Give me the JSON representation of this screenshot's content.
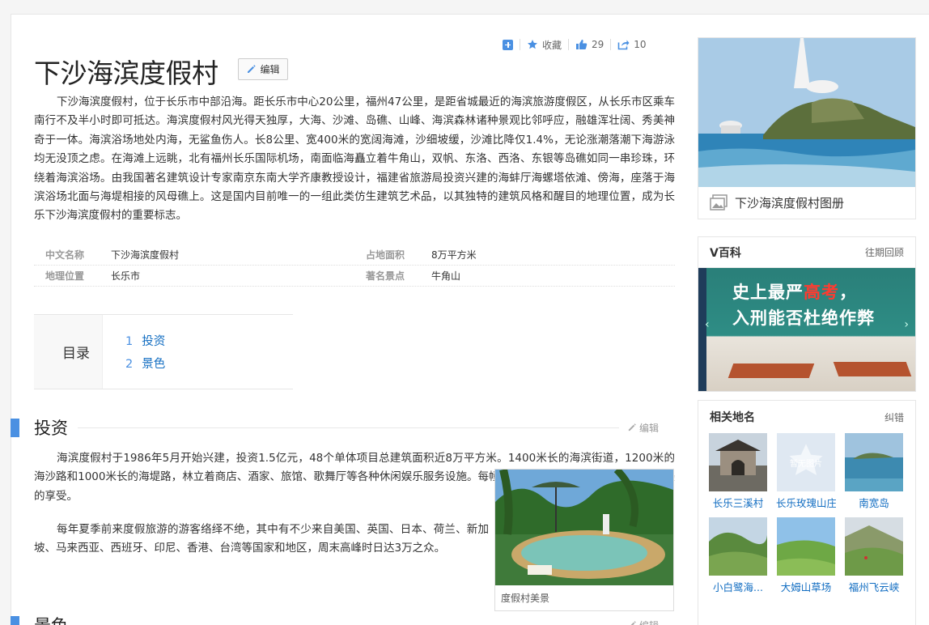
{
  "toolbar": {
    "collect_label": "收藏",
    "likes": "29",
    "shares": "10"
  },
  "title": "下沙海滨度假村",
  "edit_label": "编辑",
  "intro": "下沙海滨度假村，位于长乐市中部沿海。距长乐市中心20公里，福州47公里，是距省城最近的海滨旅游度假区，从长乐市区乘车南行不及半小时即可抵达。海滨度假村风光得天独厚，大海、沙滩、岛礁、山峰、海滨森林诸种景观比邻呼应，融雄浑壮阔、秀美神奇于一体。海滨浴场地处内海，无鲨鱼伤人。长8公里、宽400米的宽阔海滩，沙细坡缓，沙滩比降仅1.4%，无论涨潮落潮下海游泳均无没顶之虑。在海滩上远眺，北有福州长乐国际机场，南面临海矗立着牛角山，双帆、东洛、西洛、东银等岛礁如同一串珍珠，环绕着海滨浴场。由我国著名建筑设计专家南京东南大学齐康教授设计，福建省旅游局投资兴建的海蚌厅海螺塔依滩、傍海，座落于海滨浴场北面与海堤相接的风母礁上。这是国内目前唯一的一组此类仿生建筑艺术品，以其独特的建筑风格和醒目的地理位置，成为长乐下沙海滨度假村的重要标志。",
  "info": [
    {
      "k1": "中文名称",
      "v1": "下沙海滨度假村",
      "k2": "占地面积",
      "v2": "8万平方米"
    },
    {
      "k1": "地理位置",
      "v1": "长乐市",
      "k2": "著名景点",
      "v2": "牛角山"
    }
  ],
  "toc": {
    "label": "目录",
    "items": [
      {
        "num": "1",
        "text": "投资"
      },
      {
        "num": "2",
        "text": "景色"
      }
    ]
  },
  "sections": [
    {
      "title": "投资",
      "edit": "编辑"
    },
    {
      "title": "景色",
      "edit": "编辑"
    }
  ],
  "invest_p1": "海滨度假村于1986年5月开始兴建，投资1.5亿元，48个单体项目总建筑面积近8万平方米。1400米长的海滨街道，1200米的海沙路和1000米长的海堤路，林立着商店、酒家、旅馆、歌舞厅等各种休闲娱乐服务设施。每幢建筑物都有各自的风格，给人带来美的享受。",
  "invest_p2": "每年夏季前来度假旅游的游客络绎不绝，其中有不少来自美国、英国、日本、荷兰、新加坡、马来西亚、西班牙、印尼、香港、台湾等国家和地区，周末高峰时日达3万之众。",
  "figure_caption": "度假村美景",
  "album_caption": "下沙海滨度假村图册",
  "vbaike": {
    "title": "V百科",
    "more": "往期回顾",
    "banner_line1": "史上最严",
    "banner_hl": "高考",
    "banner_comma": "，",
    "banner_line2": "入刑能否杜绝作弊"
  },
  "related": {
    "title": "相关地名",
    "more": "纠错",
    "no_image": "暂无图片",
    "items": [
      {
        "name": "长乐三溪村",
        "icon": "village-gate-photo"
      },
      {
        "name": "长乐玫瑰山庄",
        "icon": "no-image-placeholder"
      },
      {
        "name": "南宽岛",
        "icon": "island-photo"
      },
      {
        "name": "小白鹭海...",
        "icon": "hills-photo"
      },
      {
        "name": "大姆山草场",
        "icon": "grassland-photo"
      },
      {
        "name": "福州飞云峡",
        "icon": "valley-photo"
      }
    ]
  },
  "colors": {
    "accent": "#4a90e2",
    "link": "#136ec2",
    "banner_highlight": "#ff3b30"
  }
}
